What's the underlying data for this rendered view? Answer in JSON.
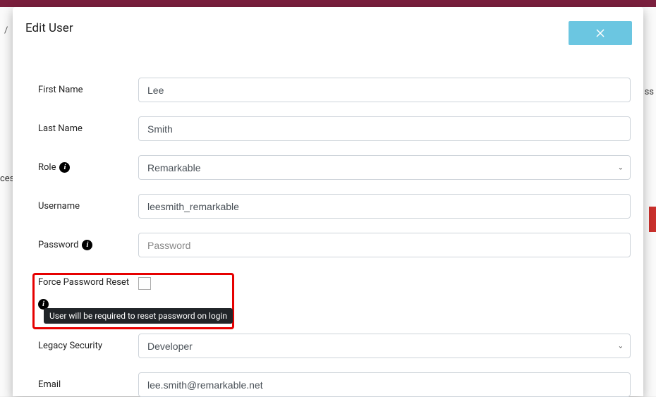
{
  "modal": {
    "title": "Edit User"
  },
  "bg": {
    "slash": "/",
    "cess": "cess",
    "ss": "ss"
  },
  "form": {
    "first_name": {
      "label": "First Name",
      "value": "Lee"
    },
    "last_name": {
      "label": "Last Name",
      "value": "Smith"
    },
    "role": {
      "label": "Role",
      "value": "Remarkable"
    },
    "username": {
      "label": "Username",
      "value": "leesmith_remarkable"
    },
    "password": {
      "label": "Password",
      "placeholder": "Password",
      "value": ""
    },
    "force_reset": {
      "label": "Force Password Reset",
      "checked": false,
      "tooltip": "User will be required to reset password on login"
    },
    "legacy_security": {
      "label": "Legacy Security",
      "value": "Developer"
    },
    "email": {
      "label": "Email",
      "value": "lee.smith@remarkable.net"
    }
  }
}
